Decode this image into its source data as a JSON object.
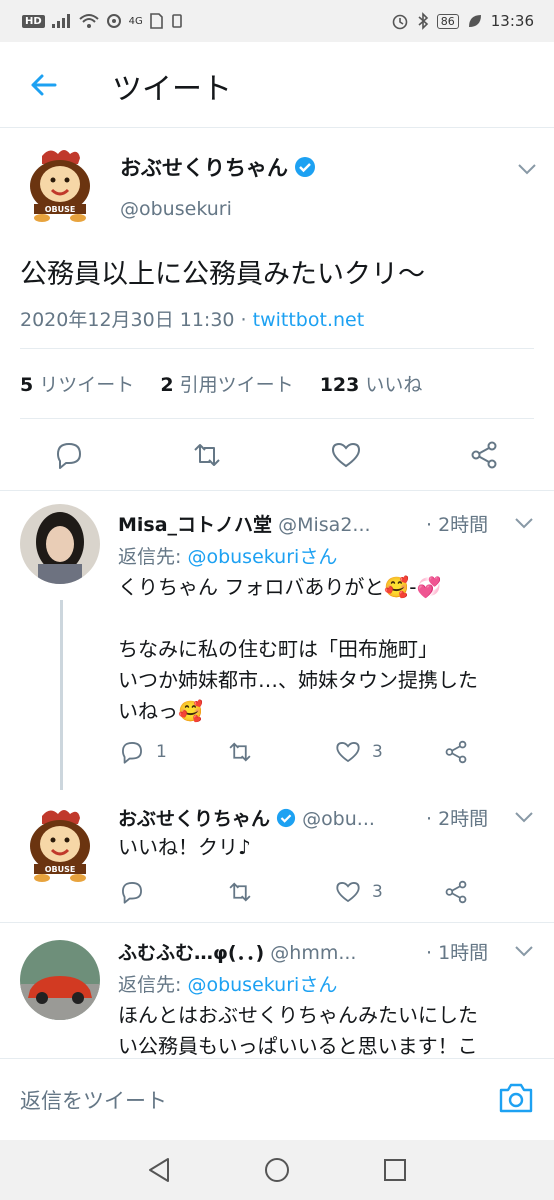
{
  "status_bar": {
    "hd": "HD",
    "signal": "4G",
    "battery": "86",
    "time": "13:36"
  },
  "header": {
    "title": "ツイート"
  },
  "tweet": {
    "author_name": "おぶせくりちゃん",
    "handle": "@obusekuri",
    "text": "公務員以上に公務員みたいクリ〜",
    "datetime": "2020年12月30日 11:30",
    "separator": " · ",
    "source": "twittbot.net",
    "retweets_count": "5",
    "retweets_label": "リツイート",
    "quotes_count": "2",
    "quotes_label": "引用ツイート",
    "likes_count": "123",
    "likes_label": "いいね"
  },
  "replies": [
    {
      "name": "Misa_コトノハ堂",
      "handle": "@Misa2...",
      "time": "· 2時間",
      "reply_to_prefix": "返信先: ",
      "reply_to_mention": "@obusekuri",
      "reply_to_suffix": "さん",
      "text": "くりちゃん フォロバありがと🥰-💞\n\nちなみに私の住む町は「田布施町」\nいつか姉妹都市…、姉妹タウン提携した\nいねっ🥰",
      "reply_count": "1",
      "retweet_count": "",
      "like_count": "3"
    },
    {
      "name": "おぶせくりちゃん",
      "handle": "@obu...",
      "time": "· 2時間",
      "text": "いいね！クリ♪",
      "reply_count": "",
      "retweet_count": "",
      "like_count": "3"
    },
    {
      "name": "ふむふむ…φ(．．)",
      "handle": "@hmm...",
      "time": "· 1時間",
      "reply_to_prefix": "返信先: ",
      "reply_to_mention": "@obusekuri",
      "reply_to_suffix": "さん",
      "text": "ほんとはおぶせくりちゃんみたいにした\nい公務員もいっぱいいると思います！こ"
    }
  ],
  "compose": {
    "placeholder": "返信をツイート"
  },
  "colors": {
    "accent": "#1da1f2",
    "secondary_text": "#657786",
    "primary_text": "#14171a"
  }
}
